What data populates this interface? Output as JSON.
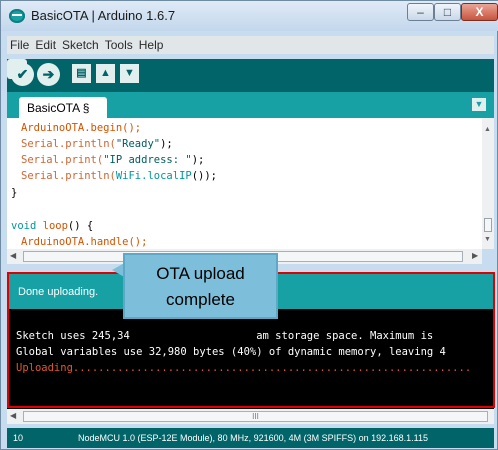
{
  "window": {
    "title": "BasicOTA | Arduino 1.6.7",
    "minimize_glyph": "–",
    "maximize_glyph": "□",
    "close_glyph": "X"
  },
  "menu": [
    "File",
    "Edit",
    "Sketch",
    "Tools",
    "Help"
  ],
  "toolbar": {
    "verify_icon": "✔",
    "upload_icon": "➔",
    "new_icon": "▤",
    "open_icon": "▲",
    "save_icon": "▼",
    "serial_monitor_icon": "⌕"
  },
  "tab": {
    "label": "BasicOTA §",
    "menu_icon": "▼"
  },
  "code": {
    "line1": "ArduinoOTA.begin();",
    "line2_a": "Serial",
    "line2_b": ".println(",
    "line2_c": "\"Ready\"",
    "line2_d": ");",
    "line3_a": "Serial",
    "line3_b": ".print(",
    "line3_c": "\"IP address: \"",
    "line3_d": ");",
    "line4_a": "Serial",
    "line4_b": ".println(",
    "line4_c": "WiFi",
    "line4_d": ".localIP",
    "line4_e": "());",
    "line5": "}",
    "line7_a": "void",
    "line7_b": " loop",
    "line7_c": "() {",
    "line8": "ArduinoOTA.handle();"
  },
  "status": "Done uploading.",
  "console": {
    "line1": "Sketch uses 245,34                    am storage space. Maximum is",
    "line2": "Global variables use 32,980 bytes (40%) of dynamic memory, leaving 4",
    "line3": "Uploading..............................................................."
  },
  "scroll_grip": "III",
  "bottom": {
    "line_number": "10",
    "board_info": "NodeMCU 1.0 (ESP-12E Module), 80 MHz, 921600, 4M (3M SPIFFS) on 192.168.1.115"
  },
  "annotation": {
    "callout_line1": "OTA upload",
    "callout_line2": "complete"
  },
  "colors": {
    "toolbar": "#006468",
    "tabstrip": "#17a1a5",
    "console_bg": "#000000",
    "highlight": "#e00000",
    "callout": "#7dbfda"
  }
}
